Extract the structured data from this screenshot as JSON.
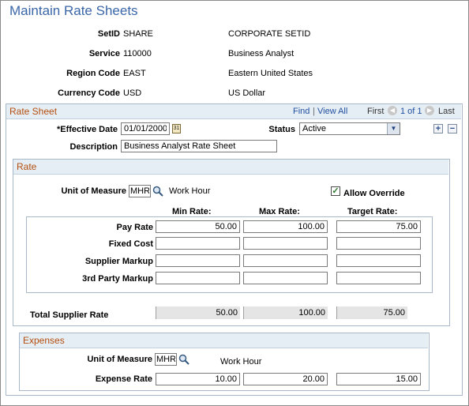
{
  "page": {
    "title": "Maintain Rate Sheets"
  },
  "header_fields": [
    {
      "label": "SetID",
      "value": "SHARE",
      "desc": "CORPORATE SETID"
    },
    {
      "label": "Service",
      "value": "110000",
      "desc": "Business Analyst"
    },
    {
      "label": "Region Code",
      "value": "EAST",
      "desc": "Eastern United States"
    },
    {
      "label": "Currency Code",
      "value": "USD",
      "desc": "US Dollar"
    }
  ],
  "rate_sheet": {
    "title": "Rate Sheet",
    "nav": {
      "find": "Find",
      "sep": "|",
      "view_all": "View All",
      "first": "First",
      "range": "1 of 1",
      "last": "Last"
    },
    "effective_date_label": "*Effective Date",
    "effective_date": "01/01/2000",
    "status_label": "Status",
    "status_value": "Active",
    "description_label": "Description",
    "description_value": "Business Analyst Rate Sheet",
    "add_label": "+",
    "remove_label": "−"
  },
  "rate": {
    "title": "Rate",
    "uom_label": "Unit of Measure",
    "uom_value": "MHR",
    "uom_desc": "Work Hour",
    "allow_override_label": "Allow Override",
    "allow_override_checked": true,
    "columns": [
      "Min Rate:",
      "Max Rate:",
      "Target Rate:"
    ],
    "rows": [
      {
        "label": "Pay Rate",
        "min": "50.00",
        "max": "100.00",
        "target": "75.00"
      },
      {
        "label": "Fixed Cost",
        "min": "",
        "max": "",
        "target": ""
      },
      {
        "label": "Supplier Markup",
        "min": "",
        "max": "",
        "target": ""
      },
      {
        "label": "3rd Party Markup",
        "min": "",
        "max": "",
        "target": ""
      }
    ],
    "total": {
      "label": "Total Supplier Rate",
      "min": "50.00",
      "max": "100.00",
      "target": "75.00"
    }
  },
  "expenses": {
    "title": "Expenses",
    "uom_label": "Unit of Measure",
    "uom_value": "MHR",
    "uom_desc": "Work Hour",
    "rate_label": "Expense Rate",
    "min": "10.00",
    "max": "20.00",
    "target": "15.00"
  },
  "icons": {
    "lookup": "magnifier-icon",
    "calendar": "calendar-icon",
    "dropdown": "chevron-down-icon",
    "prev": "arrow-left-icon",
    "next": "arrow-right-icon"
  },
  "colors": {
    "title": "#3a66a8",
    "section_header": "#b34e0e",
    "section_bg": "#e6eef5",
    "link": "#1f4f9f"
  }
}
